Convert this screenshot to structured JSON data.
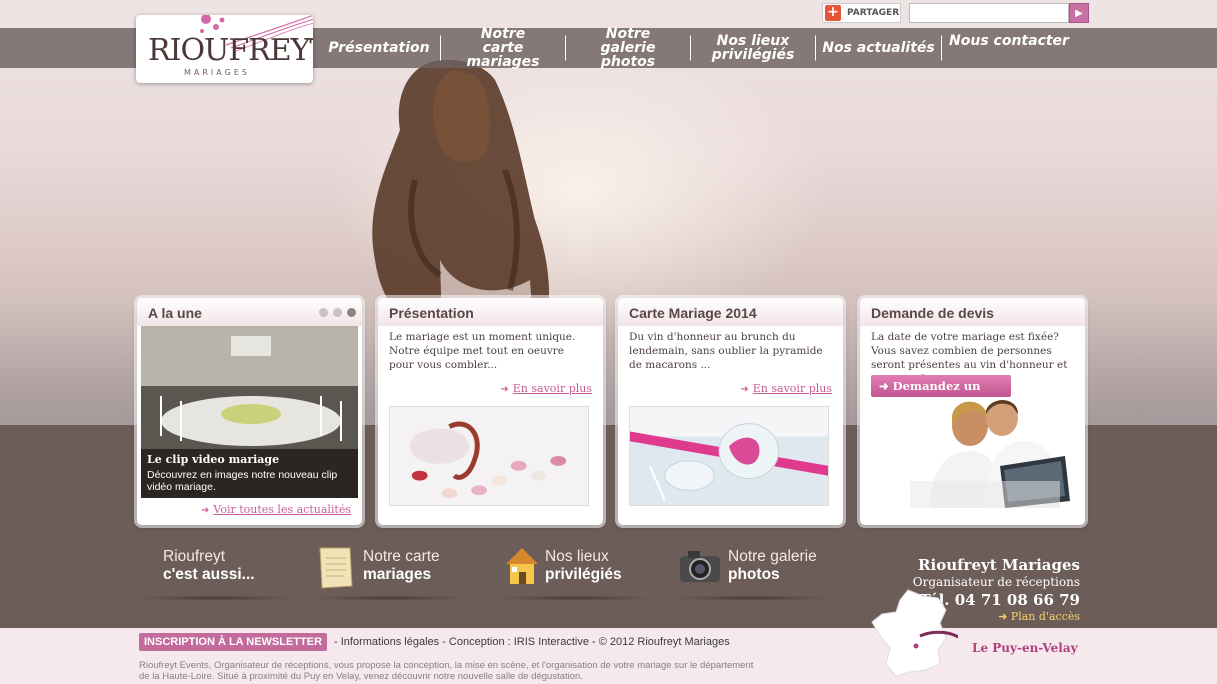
{
  "header": {
    "logo_text": "RIOUFREYT",
    "logo_subtitle": "MARIAGES",
    "share_label": "PARTAGER",
    "search_placeholder": "",
    "search_button_glyph": "▶"
  },
  "nav": [
    {
      "label": "Présentation"
    },
    {
      "label": "Notre carte mariages"
    },
    {
      "label": "Notre galerie photos"
    },
    {
      "label": "Nos lieux privilégiés"
    },
    {
      "label": "Nos actualités"
    },
    {
      "label": "Nous contacter"
    }
  ],
  "cards": {
    "news": {
      "title": "A la une",
      "caption_title": "Le clip video mariage",
      "caption_text": "Découvrez en images notre nouveau clip vidéo mariage.",
      "link": "Voir toutes les actualités"
    },
    "presentation": {
      "title": "Présentation",
      "text": "Le mariage est un moment unique. Notre équipe met tout en oeuvre pour vous combler...",
      "link": "En savoir plus"
    },
    "carte": {
      "title": "Carte Mariage 2014",
      "text": "Du vin d'honneur au brunch du lendemain, sans oublier la pyramide de macarons ...",
      "link": "En savoir plus"
    },
    "devis": {
      "title": "Demande de devis",
      "text": "La date de votre mariage est fixée? Vous savez combien de personnes seront présentes au vin d'honneur et au repas ?",
      "button": "Demandez un devis"
    }
  },
  "linkrow": {
    "intro_line1": "Rioufreyt",
    "intro_line2": "c'est aussi...",
    "carte_line1": "Notre carte",
    "carte_line2": "mariages",
    "lieux_line1": "Nos lieux",
    "lieux_line2": "privilégiés",
    "galerie_line1": "Notre galerie",
    "galerie_line2": "photos"
  },
  "contact": {
    "name": "Rioufreyt Mariages",
    "subtitle": "Organisateur de réceptions",
    "phone": "Tél. 04 71 08 66 79",
    "map_link": "Plan d'accès",
    "city": "Le Puy-en-Velay"
  },
  "footer": {
    "newsletter": "INSCRIPTION À LA NEWSLETTER",
    "links": "- Informations légales - Conception : IRIS Interactive - © 2012 Rioufreyt Mariages",
    "description": "Rioufreyt Events, Organisateur de réceptions, vous propose la conception, la mise en scène, et l'organisation de votre mariage sur le département de la Haute-Loire. Situé à proximité du Puy en Velay, venez découvrir notre nouvelle salle de dégustation."
  },
  "colors": {
    "accent_pink": "#c85e96",
    "brown_band": "#6d5d59"
  }
}
